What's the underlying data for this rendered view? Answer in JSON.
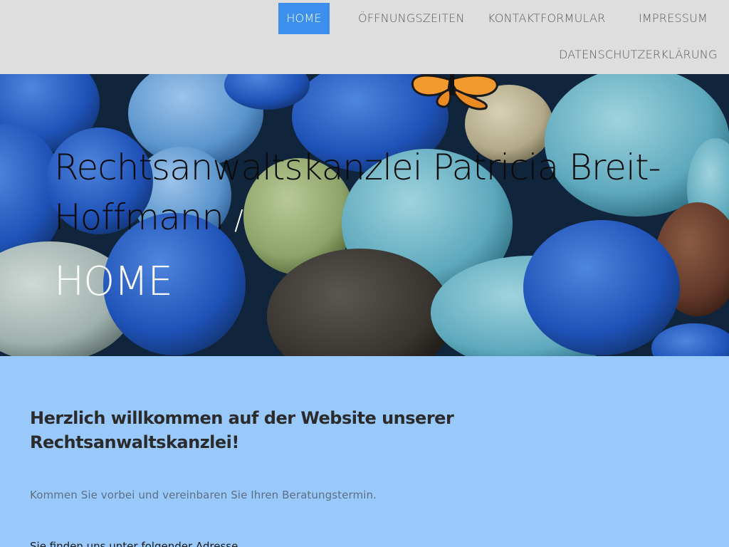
{
  "nav": {
    "items": [
      {
        "label": "HOME",
        "active": true
      },
      {
        "label": "ÖFFNUNGSZEITEN",
        "active": false
      },
      {
        "label": "KONTAKTFORMULAR",
        "active": false
      },
      {
        "label": "IMPRESSUM",
        "active": false
      },
      {
        "label": "DATENSCHUTZERKLÄRUNG",
        "active": false
      }
    ]
  },
  "hero": {
    "title": "Rechtsanwaltskanzlei Patricia Breit-Hoffmann",
    "separator": "/",
    "page_name": "HOME"
  },
  "content": {
    "welcome": "Herzlich willkommen auf der Website unserer Rechtsanwaltskanzlei!",
    "invite": "Kommen Sie vorbei und vereinbaren Sie Ihren Beratungstermin.",
    "address_intro": "Sie finden uns unter folgender Adresse"
  },
  "colors": {
    "nav_bg": "#dedede",
    "nav_active": "#3d8fee",
    "content_bg": "#99c9fb"
  }
}
